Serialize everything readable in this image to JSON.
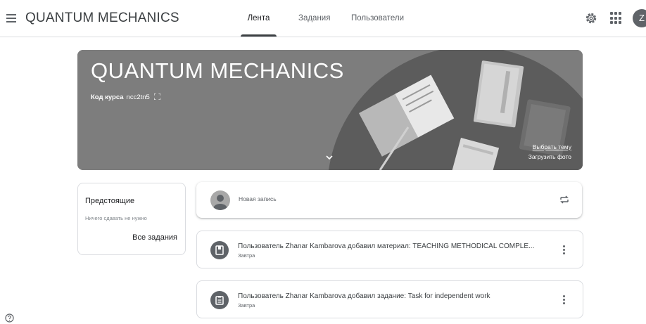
{
  "header": {
    "app_title": "QUANTUM MECHANICS",
    "tabs": [
      {
        "label": "Лента",
        "active": true
      },
      {
        "label": "Задания",
        "active": false
      },
      {
        "label": "Пользователи",
        "active": false
      }
    ],
    "avatar_letter": "Z",
    "icons": [
      "menu-icon",
      "gear-icon",
      "apps-grid-icon"
    ]
  },
  "banner": {
    "title": "QUANTUM MECHANICS",
    "code_label": "Код курса",
    "code_value": "ncc2tn5",
    "choose_theme": "Выбрать тему",
    "upload_photo": "Загрузить фото"
  },
  "upcoming": {
    "title": "Предстоящие",
    "subtitle": "Ничего сдавать не нужно",
    "link": "Все задания"
  },
  "composer": {
    "placeholder": "Новая запись"
  },
  "stream": [
    {
      "text": "Пользователь Zhanar Kambarova добавил материал: TEACHING METHODICAL COMPLE...",
      "date": "Завтра",
      "icon": "material-icon"
    },
    {
      "text": "Пользователь Zhanar Kambarova добавил задание: Task for independent work",
      "date": "Завтра",
      "icon": "assignment-icon"
    }
  ],
  "colors": {
    "banner_bg": "#7d7d7d",
    "icon_gray": "#5f6368",
    "border": "#dadce0"
  }
}
